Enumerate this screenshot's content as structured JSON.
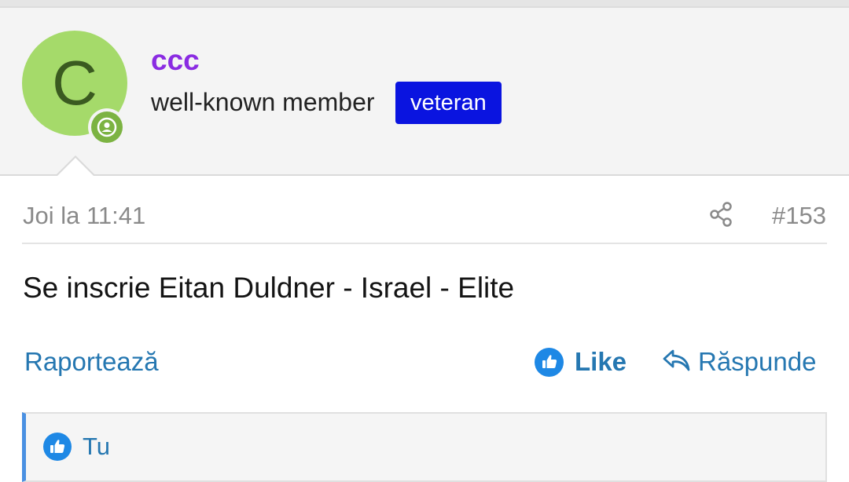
{
  "user": {
    "avatar_letter": "C",
    "username": "ccc",
    "title": "well-known member",
    "banner": "veteran"
  },
  "post": {
    "date": "Joi la 11:41",
    "number": "#153",
    "body": "Se inscrie Eitan Duldner - Israel - Elite"
  },
  "actions": {
    "report": "Raportează",
    "like": "Like",
    "reply": "Răspunde"
  },
  "reactions": {
    "names": "Tu"
  },
  "icons": {
    "online": "user-online-icon",
    "share": "share-icon",
    "like": "thumbs-up-icon",
    "reply": "reply-arrow-icon"
  },
  "colors": {
    "username": "#8a2be2",
    "banner": "#0a14e0",
    "avatar": "#a5da6a",
    "link": "#2577b1",
    "like_icon": "#1e88e5"
  }
}
